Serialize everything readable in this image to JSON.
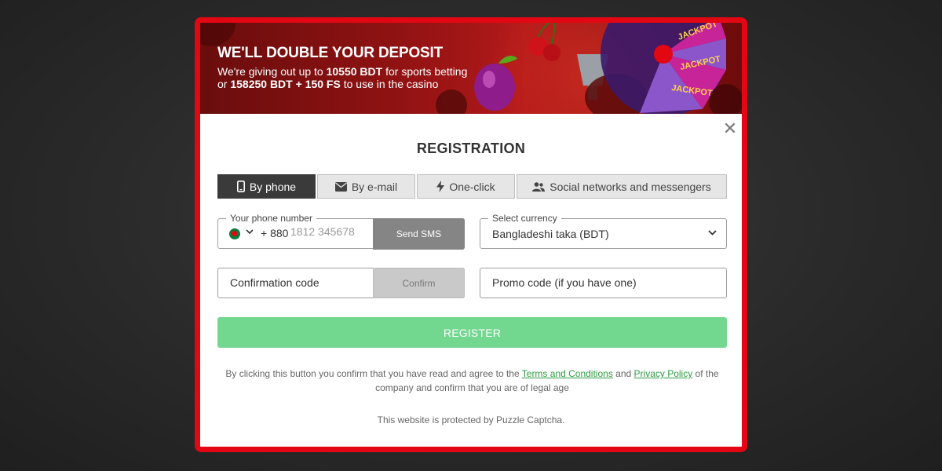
{
  "banner": {
    "title": "WE'LL DOUBLE YOUR DEPOSIT",
    "line1_pre": "We're giving out up to ",
    "line1_bold": "10550 BDT",
    "line1_post": " for sports betting",
    "line2_pre": "or ",
    "line2_bold": "158250 BDT + 150 FS",
    "line2_post": " to use in the casino"
  },
  "dialog": {
    "close_symbol": "✕",
    "title": "REGISTRATION"
  },
  "tabs": [
    {
      "label": "By phone",
      "icon": "phone-icon",
      "active": true
    },
    {
      "label": "By e-mail",
      "icon": "envelope-icon",
      "active": false
    },
    {
      "label": "One-click",
      "icon": "lightning-icon",
      "active": false
    },
    {
      "label": "Social networks and messengers",
      "icon": "users-icon",
      "active": false
    }
  ],
  "phone": {
    "legend": "Your phone number",
    "country_code": "+ 880",
    "placeholder": "1812 345678",
    "flag_icon": "bangladesh-flag-icon",
    "send_sms_label": "Send SMS"
  },
  "currency": {
    "legend": "Select currency",
    "value": "Bangladeshi taka (BDT)"
  },
  "confirmation": {
    "placeholder": "Confirmation code",
    "confirm_label": "Confirm"
  },
  "promo": {
    "placeholder": "Promo code (if you have one)"
  },
  "register_label": "REGISTER",
  "legal": {
    "pre": "By clicking this button you confirm that you have read and agree to the ",
    "terms": "Terms and Conditions",
    "and": " and ",
    "privacy": "Privacy Policy",
    "post": " of the company and confirm that you are of legal age"
  },
  "captcha_text": "This website is protected by Puzzle Captcha.",
  "colors": {
    "frame_border": "#e30613",
    "register_button": "#72d78f",
    "active_tab": "#3a3a3a",
    "link": "#2e9c44",
    "send_sms_button": "#858585"
  }
}
